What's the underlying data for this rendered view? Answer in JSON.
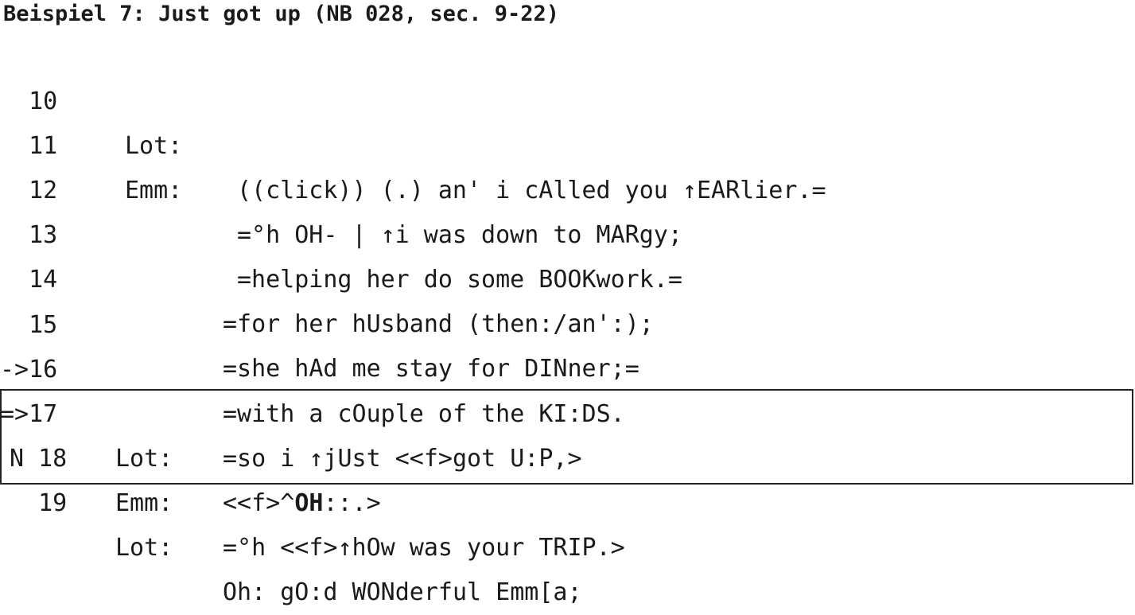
{
  "title": "Beispiel 7: Just got up (NB 028, sec. 9-22)",
  "lines": [
    {
      "num": "  10",
      "speaker": "Lot:",
      "text": "((click)) (.) an' i cAlled you ↑EARlier.="
    },
    {
      "num": "  11",
      "speaker": "Emm:",
      "text": "=°h OH- | ↑i was down to MARgy;"
    },
    {
      "num": "  12",
      "speaker": "",
      "text": "=helping her do some BOOKwork.="
    },
    {
      "num": "  13",
      "speaker": "",
      "text": "=for her hUsband (then:/an':);"
    },
    {
      "num": "  14",
      "speaker": "",
      "text": "=she hAd me stay for DINner;="
    },
    {
      "num": "  15",
      "speaker": "",
      "text": "=with a cOuple of the KI:DS."
    },
    {
      "num": "->16",
      "speaker": "",
      "text": "=so i ↑jUst <<f>got U:P,>"
    },
    {
      "num": "=>17",
      "speaker": "Lot:",
      "text_pre": "<<f>^",
      "text_bold": "OH",
      "text_post": "::.>"
    },
    {
      "num": "N 18",
      "speaker": "Emm:",
      "text": "=°h <<f>↑hOw was your TRIP.>"
    },
    {
      "num": "  19",
      "speaker": "Lot:",
      "text": "Oh: gO:d WONderful Emm[a;"
    }
  ]
}
